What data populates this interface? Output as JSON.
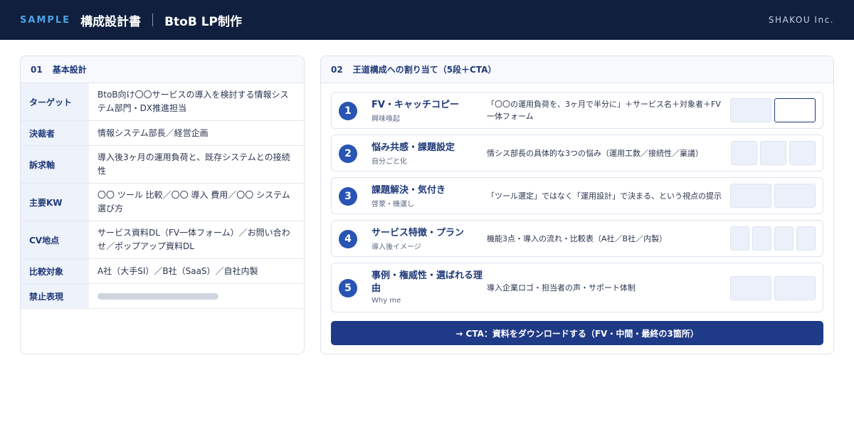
{
  "header": {
    "sample_label": "SAMPLE",
    "doc_title": "構成設計書",
    "project": "BtoB LP制作",
    "company": "SHAKOU Inc."
  },
  "basic_design": {
    "number": "01",
    "title": "基本設計",
    "rows": [
      {
        "key": "ターゲット",
        "value": "BtoB向け〇〇サービスの導入を検討する情報システム部門・DX推進担当"
      },
      {
        "key": "決裁者",
        "value": "情報システム部長／経営企画"
      },
      {
        "key": "訴求軸",
        "value": "導入後3ヶ月の運用負荷と、既存システムとの接続性"
      },
      {
        "key": "主要KW",
        "value": "〇〇 ツール 比較／〇〇 導入 費用／〇〇 システム 選び方"
      },
      {
        "key": "CV地点",
        "value": "サービス資料DL（FV一体フォーム）／お問い合わせ／ポップアップ資料DL"
      },
      {
        "key": "比較対象",
        "value": "A社（大手SI）／B社（SaaS）／自社内製"
      },
      {
        "key": "禁止表現",
        "value": ""
      }
    ]
  },
  "structure": {
    "number": "02",
    "title": "王道構成への割り当て（5段＋CTA）",
    "sections": [
      {
        "num": "1",
        "title": "FV・キャッチコピー",
        "subtitle": "興味喚起",
        "description": "「〇〇の運用負荷を、3ヶ月で半分に」＋サービス名＋対象者＋FV一体フォーム"
      },
      {
        "num": "2",
        "title": "悩み共感・課題設定",
        "subtitle": "自分ごと化",
        "description": "情シス部長の具体的な3つの悩み（運用工数／接続性／稟議）"
      },
      {
        "num": "3",
        "title": "課題解決・気付き",
        "subtitle": "啓蒙・機運し",
        "description": "「ツール選定」ではなく「運用設計」で決まる、という視点の提示"
      },
      {
        "num": "4",
        "title": "サービス特徴・プラン",
        "subtitle": "導入後イメージ",
        "description": "機能3点・導入の流れ・比較表（A社／B社／内製）"
      },
      {
        "num": "5",
        "title": "事例・権威性・選ばれる理由",
        "subtitle": "Why me",
        "description": "導入企業ロゴ・担当者の声・サポート体制"
      }
    ],
    "cta_label": "→ CTA：資料をダウンロードする（FV・中間・最終の3箇所）"
  }
}
